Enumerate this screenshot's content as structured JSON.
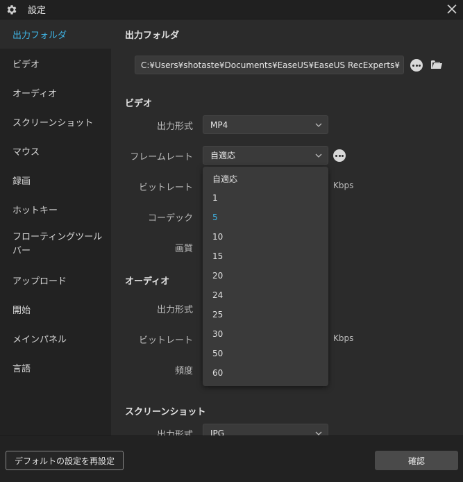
{
  "window": {
    "title": "設定",
    "gear_icon": "gear-icon",
    "close_icon": "close-icon"
  },
  "sidebar": {
    "items": [
      {
        "label": "出力フォルダ",
        "active": true
      },
      {
        "label": "ビデオ"
      },
      {
        "label": "オーディオ"
      },
      {
        "label": "スクリーンショット"
      },
      {
        "label": "マウス"
      },
      {
        "label": "録画"
      },
      {
        "label": "ホットキー"
      },
      {
        "label": "フローティングツールバー"
      },
      {
        "label": "アップロード"
      },
      {
        "label": "開始"
      },
      {
        "label": "メインパネル"
      },
      {
        "label": "言語"
      }
    ],
    "active_color": "#3fb5e6"
  },
  "output_folder": {
    "title": "出力フォルダ",
    "path": "C:¥Users¥shotaste¥Documents¥EaseUS¥EaseUS RecExperts¥"
  },
  "video": {
    "title": "ビデオ",
    "format_label": "出力形式",
    "format_value": "MP4",
    "framerate_label": "フレームレート",
    "framerate_value": "自適応",
    "bitrate_label": "ビットレート",
    "bitrate_unit": "Kbps",
    "codec_label": "コーデック",
    "quality_label": "画質"
  },
  "audio": {
    "title": "オーディオ",
    "format_label": "出力形式",
    "bitrate_label": "ビットレート",
    "bitrate_unit": "Kbps",
    "frequency_label": "頻度"
  },
  "screenshot": {
    "title": "スクリーンショット",
    "format_label": "出力形式",
    "format_value": "JPG"
  },
  "framerate_dropdown": {
    "options": [
      "自適応",
      "1",
      "5",
      "10",
      "15",
      "20",
      "24",
      "25",
      "30",
      "50",
      "60"
    ],
    "highlighted": "5"
  },
  "footer": {
    "reset_label": "デフォルトの設定を再設定",
    "ok_label": "確認"
  }
}
